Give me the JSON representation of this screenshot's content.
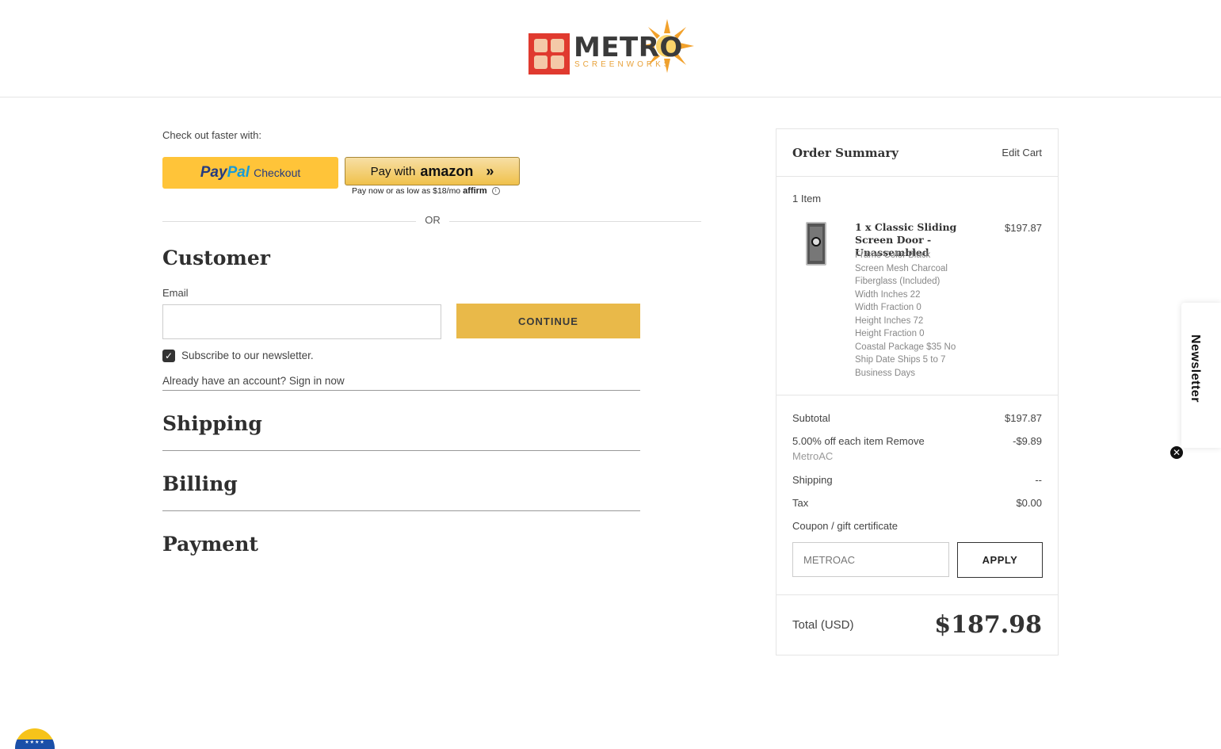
{
  "brand": {
    "name": "METRO",
    "tagline": "SCREENWORKS"
  },
  "checkout": {
    "fast_label": "Check out faster with:",
    "paypal": {
      "pay": "Pay",
      "pal": "Pal",
      "checkout": "Checkout"
    },
    "amazon": {
      "pay_with": "Pay with",
      "word": "amazon"
    },
    "affirm": {
      "text": "Pay now or as low as $18/mo",
      "brand": "affirm"
    },
    "or": "OR"
  },
  "customer": {
    "title": "Customer",
    "email_label": "Email",
    "email_value": "",
    "continue_label": "CONTINUE",
    "subscribe_label": "Subscribe to our newsletter.",
    "subscribed": true,
    "signin_text": "Already have an account? Sign in now"
  },
  "sections": {
    "shipping": "Shipping",
    "billing": "Billing",
    "payment": "Payment"
  },
  "summary": {
    "title": "Order Summary",
    "edit_cart": "Edit Cart",
    "items_count": "1 Item",
    "product": {
      "name": "1 x Classic Sliding Screen Door - Unassembled",
      "price": "$197.87",
      "options": [
        "Frame Color Black",
        "Screen Mesh Charcoal Fiberglass (Included)",
        "Width Inches 22",
        "Width Fraction 0",
        "Height Inches 72",
        "Height Fraction 0",
        "Coastal Package $35 No",
        "Ship Date Ships 5 to 7 Business Days"
      ]
    },
    "subtotal_label": "Subtotal",
    "subtotal_value": "$197.87",
    "discount_label": "5.00% off each item Remove",
    "discount_code": "MetroAC",
    "discount_value": "-$9.89",
    "shipping_label": "Shipping",
    "shipping_value": "--",
    "tax_label": "Tax",
    "tax_value": "$0.00",
    "coupon_label": "Coupon / gift certificate",
    "coupon_value": "METROAC",
    "apply_label": "APPLY",
    "total_label": "Total (USD)",
    "total_value": "$187.98"
  },
  "newsletter_tab": {
    "label": "Newsletter",
    "close": "✕"
  },
  "colors": {
    "accent_button": "#e9b949",
    "paypal_yellow": "#ffc439",
    "brand_red": "#e03a2f",
    "brand_orange": "#e8a23b"
  }
}
